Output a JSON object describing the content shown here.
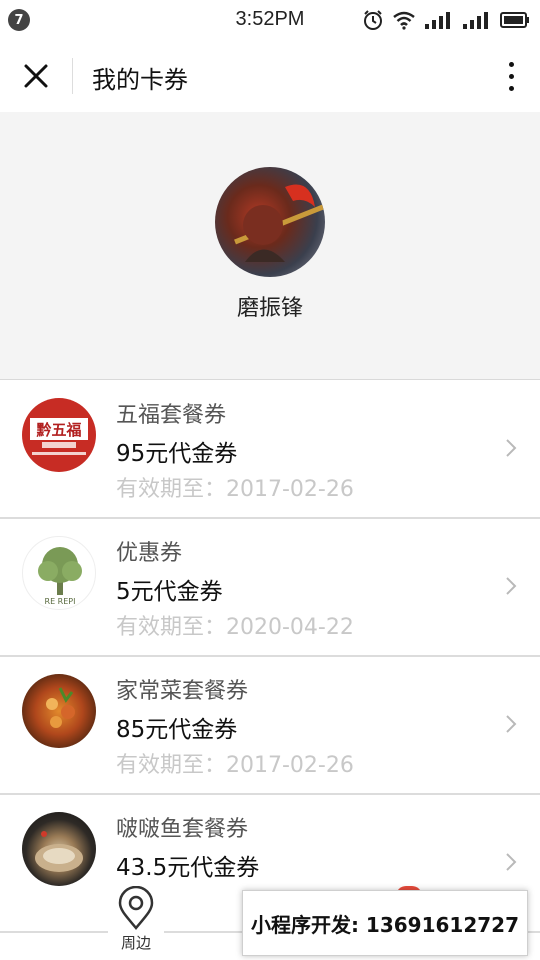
{
  "status_bar": {
    "notification_count": "7",
    "time": "3:52PM",
    "icons": [
      "alarm-icon",
      "wifi-icon",
      "signal-icon",
      "signal-icon",
      "battery-icon"
    ]
  },
  "nav": {
    "title": "我的卡券",
    "close_icon": "close-icon",
    "more_icon": "more-vertical-icon"
  },
  "profile": {
    "name": "磨振锋"
  },
  "coupons": [
    {
      "name": "五福套餐券",
      "value": "95元代金券",
      "expiry": "有效期至：2017-02-26",
      "logo_text": "黔五福"
    },
    {
      "name": "优惠券",
      "value": "5元代金券",
      "expiry": "有效期至：2020-04-22",
      "logo_text": "RE REPI"
    },
    {
      "name": "家常菜套餐券",
      "value": "85元代金券",
      "expiry": "有效期至：2017-02-26"
    },
    {
      "name": "啵啵鱼套餐券",
      "value": "43.5元代金券",
      "expiry": ""
    }
  ],
  "bottom_bar": {
    "nearby_label": "周边",
    "promo_text": "小程序开发: 13691612727"
  },
  "colors": {
    "divider": "#dcdcdc",
    "expiry_text": "#c8c8c8",
    "logo_red": "#c72c24"
  }
}
